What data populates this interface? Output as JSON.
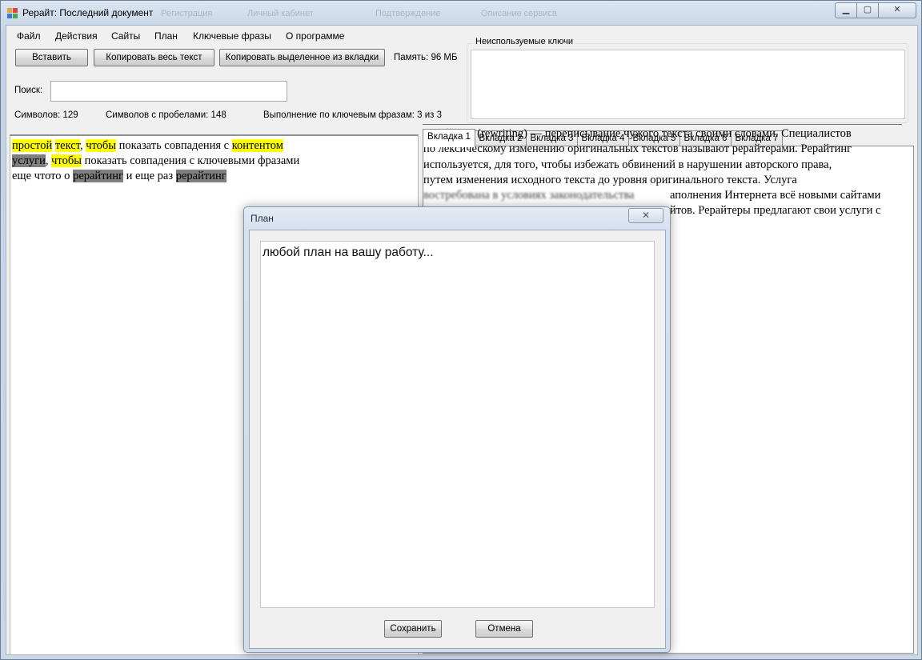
{
  "window": {
    "title": "Рерайт: Последний документ",
    "ghost_tabs": [
      "Регистрация",
      "Личный кабинет",
      "Подтверждение",
      "Описание сервиса"
    ],
    "controls": {
      "minimize": "▁",
      "maximize": "▢",
      "close": "✕"
    }
  },
  "menu": [
    "Файл",
    "Действия",
    "Сайты",
    "План",
    "Ключевые фразы",
    "О программе"
  ],
  "toolbar": {
    "paste": "Вставить",
    "copy_all": "Копировать весь текст",
    "copy_selected": "Копировать выделенное из вкладки",
    "memory": "Память: 96 МБ"
  },
  "search": {
    "label": "Поиск:",
    "value": ""
  },
  "stats": {
    "chars": "Символов: 129",
    "chars_spaces": "Символов с пробелами: 148",
    "keywords": "Выполнение по ключевым фразам: 3 из 3"
  },
  "unused_keys": {
    "label": "Неиспользуемые ключи"
  },
  "editor": {
    "lines": [
      [
        {
          "t": "простой",
          "h": "y"
        },
        {
          "t": " "
        },
        {
          "t": "текст",
          "h": "y"
        },
        {
          "t": ", "
        },
        {
          "t": "чтобы",
          "h": "y"
        },
        {
          "t": " показать совпадения с "
        },
        {
          "t": "контентом",
          "h": "y"
        }
      ],
      [
        {
          "t": "услуги",
          "h": "g"
        },
        {
          "t": ", "
        },
        {
          "t": "чтобы",
          "h": "y"
        },
        {
          "t": " показать совпадения с ключевыми фразами"
        }
      ],
      [
        {
          "t": "еще чтото о "
        },
        {
          "t": "рерайтинг",
          "h": "g"
        },
        {
          "t": " и еще раз "
        },
        {
          "t": "рерайтинг",
          "h": "g"
        }
      ]
    ]
  },
  "tabs": [
    "Вкладка 1",
    "Вкладка 2",
    "Вкладка 3",
    "Вкладка 4",
    "Вкладка 5",
    "Вкладка 6",
    "Вкладка 7"
  ],
  "tab_content": {
    "line1": "Рерайтинг (rewriting) — переписывание чужого текста своими словами. Специалистов",
    "line2": "по лексическому изменению оригинальных текстов называют рерайтерами. Рерайтинг",
    "line3": "используется, для того, чтобы избежать обвинений в нарушении авторского права,",
    "line4": "путем изменения исходного текста до уровня оригинального текста. Услуга",
    "line5_blur": "востребована в условиях законодательства",
    "line5_end": "аполнения Интернета всё новыми сайтами",
    "line6_end": "йтов. Рерайтеры предлагают свои услуги с",
    "line7_end": "."
  },
  "dialog": {
    "title": "План",
    "close": "✕",
    "text": "любой план на вашу работу...",
    "save": "Сохранить",
    "cancel": "Отмена"
  }
}
